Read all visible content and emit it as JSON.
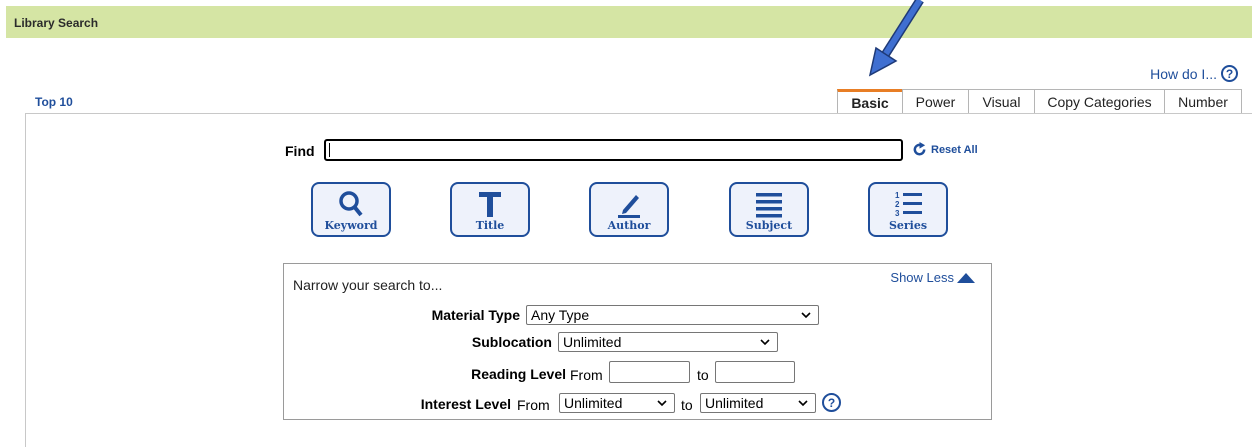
{
  "header": {
    "title": "Library Search"
  },
  "help": {
    "label": "How do I...",
    "icon": "help-icon"
  },
  "top10": {
    "label": "Top 10"
  },
  "tabs": [
    {
      "label": "Basic",
      "active": true
    },
    {
      "label": "Power",
      "active": false
    },
    {
      "label": "Visual",
      "active": false
    },
    {
      "label": "Copy Categories",
      "active": false
    },
    {
      "label": "Number",
      "active": false
    }
  ],
  "find": {
    "label": "Find",
    "value": "",
    "reset_label": "Reset All"
  },
  "search_buttons": [
    {
      "label": "Keyword",
      "icon": "magnifier-icon"
    },
    {
      "label": "Title",
      "icon": "title-t-icon"
    },
    {
      "label": "Author",
      "icon": "pen-icon"
    },
    {
      "label": "Subject",
      "icon": "lines-icon"
    },
    {
      "label": "Series",
      "icon": "numbered-list-icon"
    }
  ],
  "narrow": {
    "header": "Narrow your search to...",
    "show_less": "Show Less",
    "material_type": {
      "label": "Material Type",
      "value": "Any Type"
    },
    "sublocation": {
      "label": "Sublocation",
      "value": "Unlimited"
    },
    "reading_level": {
      "label": "Reading Level",
      "from_label": "From",
      "to_label": "to",
      "from_value": "",
      "to_value": ""
    },
    "interest_level": {
      "label": "Interest Level",
      "from_label": "From",
      "to_label": "to",
      "from_value": "Unlimited",
      "to_value": "Unlimited"
    }
  },
  "colors": {
    "header_bg": "#d5e5a4",
    "link": "#1f4e9b",
    "active_tab": "#e87e25",
    "annotation_arrow": "#3f6fd1"
  }
}
